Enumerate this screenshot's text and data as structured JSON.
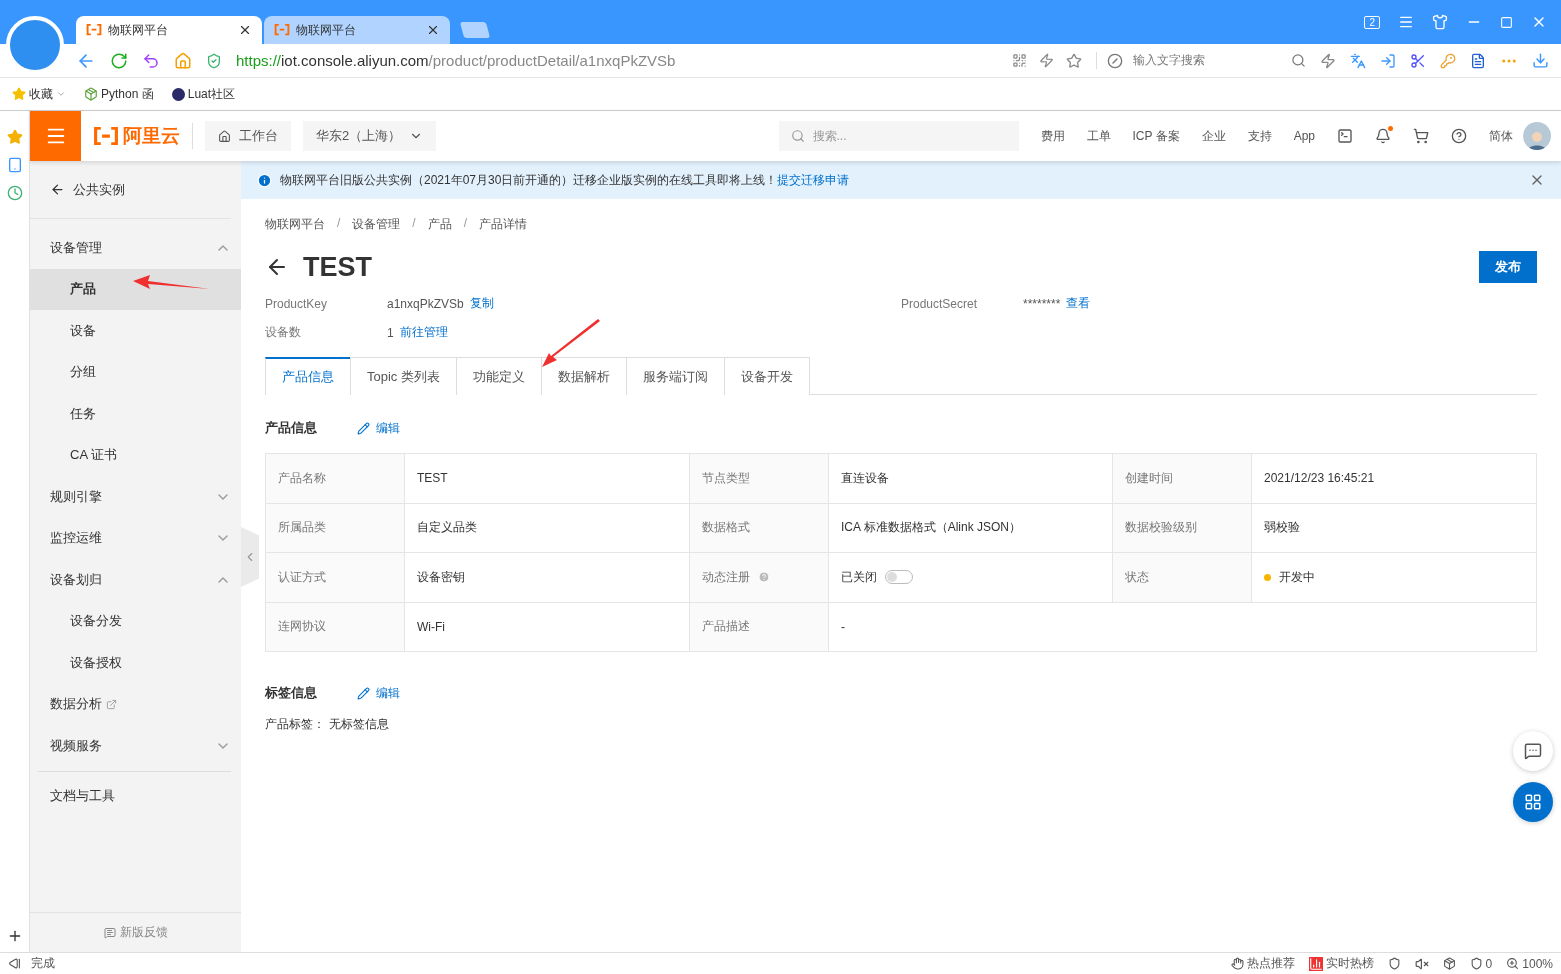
{
  "browser": {
    "tabs": [
      {
        "title": "物联网平台",
        "selected": true
      },
      {
        "title": "物联网平台",
        "selected": false
      }
    ],
    "tab_count": "2",
    "url": {
      "scheme": "https://",
      "host": "iot.console.aliyun.com",
      "path": "/product/productDetail/a1nxqPkZVSb"
    },
    "search_placeholder": "输入文字搜索",
    "bookmarks": [
      {
        "label": "收藏",
        "kind": "folder"
      },
      {
        "label": "Python 函",
        "kind": "python"
      },
      {
        "label": "Luat社区",
        "kind": "luat"
      }
    ]
  },
  "console_header": {
    "logo": "阿里云",
    "workbench": "工作台",
    "region": "华东2（上海）",
    "search_placeholder": "搜索...",
    "nav": [
      "费用",
      "工单",
      "ICP 备案",
      "企业",
      "支持",
      "App"
    ],
    "notifications_unread": true,
    "language": "简体"
  },
  "sidebar": {
    "back": "公共实例",
    "items": [
      {
        "kind": "group",
        "label": "设备管理",
        "expanded": true,
        "children": [
          {
            "label": "产品",
            "selected": true
          },
          {
            "label": "设备",
            "selected": false
          },
          {
            "label": "分组",
            "selected": false
          },
          {
            "label": "任务",
            "selected": false
          },
          {
            "label": "CA 证书",
            "selected": false
          }
        ]
      },
      {
        "kind": "group",
        "label": "规则引擎",
        "expanded": false
      },
      {
        "kind": "group",
        "label": "监控运维",
        "expanded": false
      },
      {
        "kind": "group",
        "label": "设备划归",
        "expanded": true,
        "children": [
          {
            "label": "设备分发",
            "selected": false
          },
          {
            "label": "设备授权",
            "selected": false
          }
        ]
      },
      {
        "kind": "external",
        "label": "数据分析"
      },
      {
        "kind": "group",
        "label": "视频服务",
        "expanded": false
      }
    ],
    "docs": "文档与工具",
    "feedback": "新版反馈"
  },
  "banner": {
    "text": "物联网平台旧版公共实例（2021年07月30日前开通的）迁移企业版实例的在线工具即将上线！",
    "link": "提交迁移申请"
  },
  "breadcrumb": {
    "separator": "/",
    "items": [
      "物联网平台",
      "设备管理",
      "产品",
      "产品详情"
    ]
  },
  "title": "TEST",
  "publish_button": "发布",
  "meta": [
    {
      "label": "ProductKey",
      "value": "a1nxqPkZVSb",
      "link": "复制"
    },
    {
      "label": "ProductSecret",
      "value": "********",
      "link": "查看"
    },
    {
      "label": "设备数",
      "value": "1",
      "link": "前往管理"
    }
  ],
  "tabs": [
    {
      "label": "产品信息",
      "selected": true
    },
    {
      "label": "Topic 类列表",
      "selected": false
    },
    {
      "label": "功能定义",
      "selected": false
    },
    {
      "label": "数据解析",
      "selected": false
    },
    {
      "label": "服务端订阅",
      "selected": false
    },
    {
      "label": "设备开发",
      "selected": false
    }
  ],
  "product_info": {
    "title": "产品信息",
    "edit": "编辑",
    "rows": [
      [
        {
          "label": "产品名称",
          "value": "TEST"
        },
        {
          "label": "节点类型",
          "value": "直连设备"
        },
        {
          "label": "创建时间",
          "value": "2021/12/23 16:45:21"
        }
      ],
      [
        {
          "label": "所属品类",
          "value": "自定义品类"
        },
        {
          "label": "数据格式",
          "value": "ICA 标准数据格式（Alink JSON）"
        },
        {
          "label": "数据校验级别",
          "value": "弱校验"
        }
      ],
      [
        {
          "label": "认证方式",
          "value": "设备密钥"
        },
        {
          "label": "动态注册",
          "value": "已关闭",
          "help": true,
          "kind": "switch",
          "on": false
        },
        {
          "label": "状态",
          "value": "开发中",
          "kind": "status",
          "color": "#f7b500"
        }
      ],
      [
        {
          "label": "连网协议",
          "value": "Wi-Fi"
        },
        {
          "label": "产品描述",
          "value": "-"
        }
      ]
    ]
  },
  "tag_info": {
    "title": "标签信息",
    "edit": "编辑",
    "label": "产品标签：",
    "value": "无标签信息"
  },
  "status_bar": {
    "left": "完成",
    "hot": "热点推荐",
    "trending": "实时热榜",
    "blocked": "0",
    "zoom": "100%"
  }
}
